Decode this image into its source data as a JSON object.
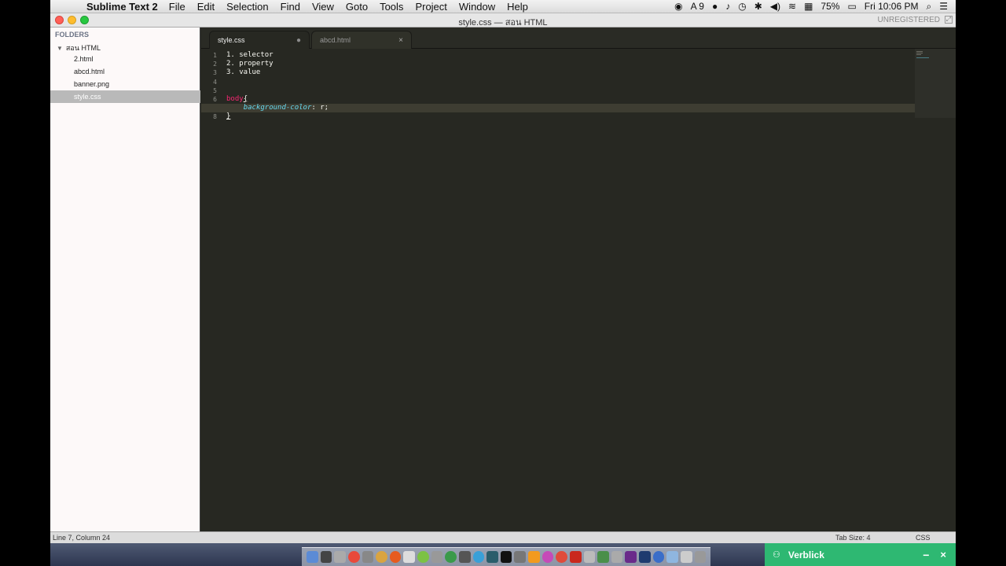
{
  "menubar": {
    "app_name": "Sublime Text 2",
    "items": [
      "File",
      "Edit",
      "Selection",
      "Find",
      "View",
      "Goto",
      "Tools",
      "Project",
      "Window",
      "Help"
    ],
    "status": {
      "ai_badge": "9",
      "battery": "75%",
      "clock": "Fri 10:06 PM"
    }
  },
  "window": {
    "title": "style.css — สอน HTML",
    "unregistered": "UNREGISTERED"
  },
  "sidebar": {
    "heading": "FOLDERS",
    "root_folder": "สอน HTML",
    "files": [
      {
        "name": "2.html",
        "selected": false
      },
      {
        "name": "abcd.html",
        "selected": false
      },
      {
        "name": "banner.png",
        "selected": false
      },
      {
        "name": "style.css",
        "selected": true
      }
    ]
  },
  "tabs": [
    {
      "label": "style.css",
      "active": true,
      "marker": "●"
    },
    {
      "label": "abcd.html",
      "active": false,
      "marker": "×"
    }
  ],
  "editor": {
    "lines": [
      {
        "n": "1",
        "text": "1. selector"
      },
      {
        "n": "2",
        "text": "2. property"
      },
      {
        "n": "3",
        "text": "3. value"
      },
      {
        "n": "4",
        "text": ""
      },
      {
        "n": "5",
        "text": ""
      },
      {
        "n": "6",
        "selector": "body",
        "brace": "{"
      },
      {
        "n": "7",
        "prop": "background-color",
        "rest": ": r;"
      },
      {
        "n": "8",
        "brace": "}"
      }
    ],
    "current_line": 7
  },
  "statusbar": {
    "position": "Line 7, Column 24",
    "tab_size": "Tab Size: 4",
    "syntax": "CSS"
  },
  "notification": {
    "label": "Verblick",
    "minimize": "−",
    "close": "×"
  },
  "colors": {
    "editor_bg": "#272822",
    "selector": "#f92672",
    "property": "#66d9ef",
    "notification": "#2eb872"
  }
}
